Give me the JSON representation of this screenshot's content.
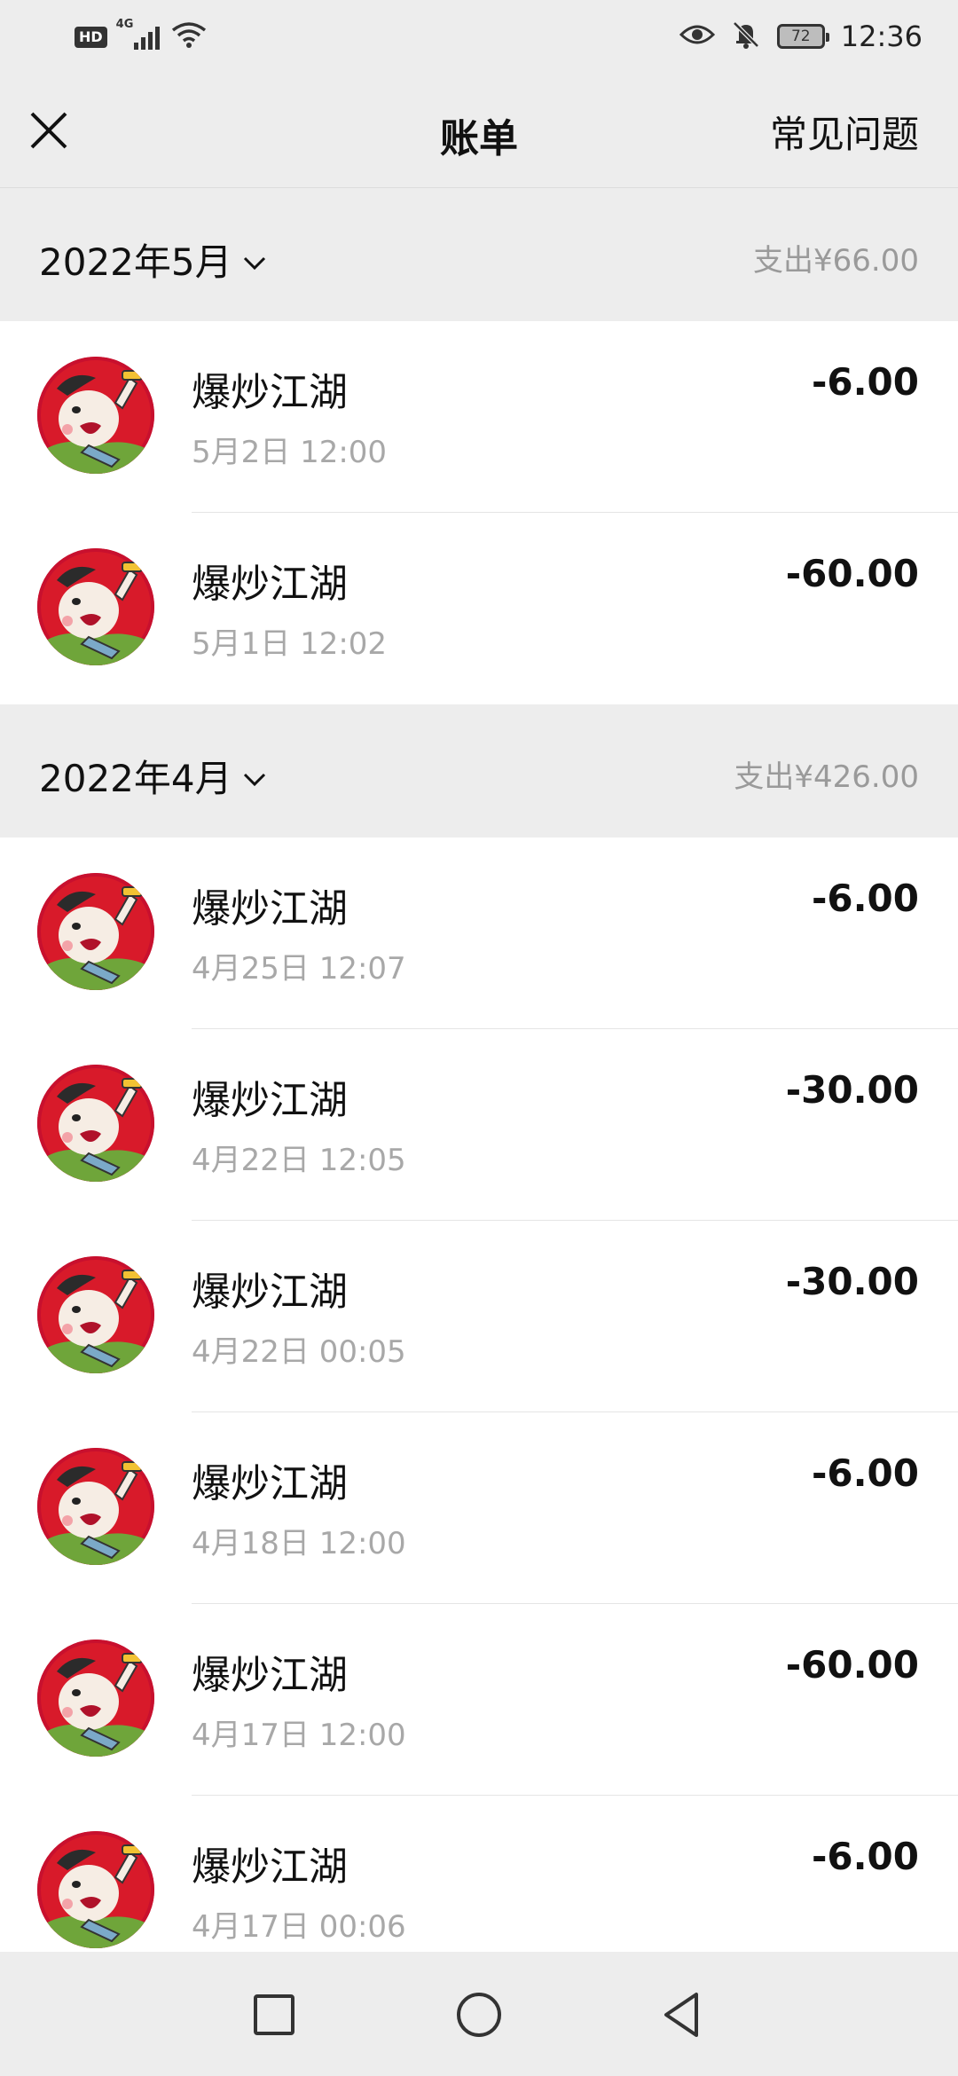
{
  "status_bar": {
    "hd": "HD",
    "network": "4G",
    "battery": "72",
    "time": "12:36"
  },
  "nav": {
    "title": "账单",
    "faq": "常见问题"
  },
  "months": [
    {
      "label": "2022年5月",
      "total": "支出¥66.00",
      "transactions": [
        {
          "name": "爆炒江湖",
          "time": "5月2日 12:00",
          "amount": "-6.00"
        },
        {
          "name": "爆炒江湖",
          "time": "5月1日 12:02",
          "amount": "-60.00"
        }
      ]
    },
    {
      "label": "2022年4月",
      "total": "支出¥426.00",
      "transactions": [
        {
          "name": "爆炒江湖",
          "time": "4月25日 12:07",
          "amount": "-6.00"
        },
        {
          "name": "爆炒江湖",
          "time": "4月22日 12:05",
          "amount": "-30.00"
        },
        {
          "name": "爆炒江湖",
          "time": "4月22日 00:05",
          "amount": "-30.00"
        },
        {
          "name": "爆炒江湖",
          "time": "4月18日 12:00",
          "amount": "-6.00"
        },
        {
          "name": "爆炒江湖",
          "time": "4月17日 12:00",
          "amount": "-60.00"
        },
        {
          "name": "爆炒江湖",
          "time": "4月17日 00:06",
          "amount": "-6.00"
        }
      ]
    }
  ],
  "icons": {
    "close": "close-icon",
    "chevron": "chevron-down-icon",
    "recents": "square-icon",
    "home": "circle-icon",
    "back": "triangle-back-icon"
  },
  "colors": {
    "background": "#ededed",
    "card": "#ffffff",
    "secondary_text": "#a8a8a8",
    "avatar_red": "#c8102e"
  }
}
